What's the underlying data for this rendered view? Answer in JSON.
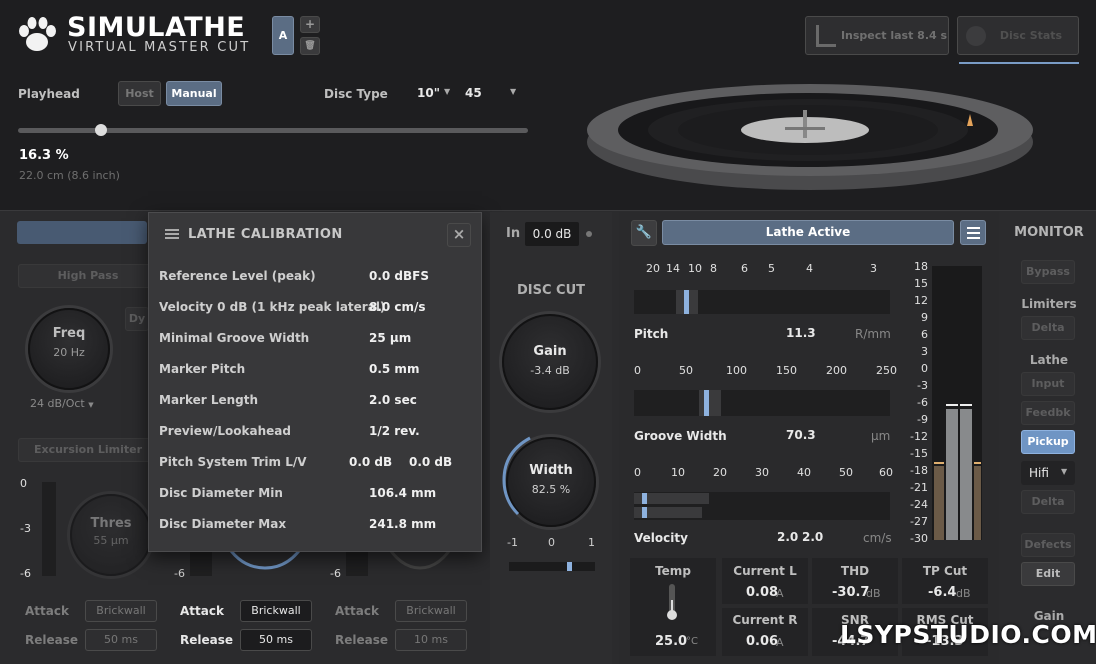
{
  "header": {
    "title": "SIMULATHE",
    "subtitle": "VIRTUAL MASTER CUT",
    "preset_slot": "A",
    "add_label": "+",
    "delete_label": "🗑",
    "inspect_label": "Inspect last 8.4 s",
    "disc_stats_label": "Disc Stats"
  },
  "playhead": {
    "label": "Playhead",
    "host_label": "Host",
    "manual_label": "Manual",
    "percent": "16.3 %",
    "position_value": 0.163,
    "distance": "22.0 cm (8.6 inch)"
  },
  "disc_type": {
    "label": "Disc Type",
    "size": "10\"",
    "speed": "45"
  },
  "calibration": {
    "title": "LATHE CALIBRATION",
    "rows": [
      {
        "label": "Reference Level (peak)",
        "value": "0.0 dBFS"
      },
      {
        "label": "Velocity 0 dB (1 kHz peak lateral)",
        "value": "8.0 cm/s"
      },
      {
        "label": "Minimal Groove Width",
        "value": "25 µm"
      },
      {
        "label": "Marker Pitch",
        "value": "0.5 mm"
      },
      {
        "label": "Marker Length",
        "value": "2.0 sec"
      },
      {
        "label": "Preview/Lookahead",
        "value": "1/2 rev."
      },
      {
        "label": "Pitch System Trim L/V",
        "value": "0.0 dB",
        "value2": "0.0 dB"
      },
      {
        "label": "Disc Diameter Min",
        "value": "106.4 mm"
      },
      {
        "label": "Disc Diameter Max",
        "value": "241.8 mm"
      }
    ]
  },
  "left_section": {
    "high_pass_label": "High Pass",
    "freq_label": "Freq",
    "freq_value": "20 Hz",
    "slope": "24 dB/Oct",
    "dyn_label": "Dy",
    "excursion_label": "Excursion Limiter",
    "scale": [
      "0",
      "-3",
      "-6"
    ],
    "scale_mid": [
      "-6",
      "-6"
    ],
    "thres_label": "Thres",
    "thres_value": "55 µm",
    "attack_label": "Attack",
    "release_label": "Release",
    "attack_values": [
      "Brickwall",
      "Brickwall",
      "Brickwall"
    ],
    "release_values": [
      "50 ms",
      "50 ms",
      "10 ms"
    ]
  },
  "disc_cut": {
    "in_label": "In",
    "in_value": "0.0 dB",
    "title": "DISC CUT",
    "gain_label": "Gain",
    "gain_value": "-3.4 dB",
    "width_label": "Width",
    "width_value": "82.5 %",
    "balance_scale": [
      "-1",
      "0",
      "1"
    ],
    "balance_value": 0.68
  },
  "lathe": {
    "status": "Lathe Active",
    "pitch_scale": [
      "20",
      "14",
      "10",
      "8",
      "6",
      "5",
      "4",
      "3"
    ],
    "pitch_label": "Pitch",
    "pitch_value": "11.3",
    "pitch_unit": "R/mm",
    "groove_scale": [
      "0",
      "50",
      "100",
      "150",
      "200",
      "250"
    ],
    "groove_label": "Groove Width",
    "groove_value": "70.3",
    "groove_unit": "µm",
    "velocity_scale": [
      "0",
      "10",
      "20",
      "30",
      "40",
      "50",
      "60"
    ],
    "velocity_label": "Velocity",
    "velocity_l": "2.0",
    "velocity_r": "2.0",
    "velocity_unit": "cm/s",
    "temp_label": "Temp",
    "temp_value": "25.0",
    "temp_unit": "°C",
    "current_l_label": "Current L",
    "current_l_value": "0.08",
    "current_r_label": "Current R",
    "current_r_value": "0.06",
    "current_unit": "A",
    "thd_label": "THD",
    "thd_value": "-30.7",
    "snr_label": "SNR",
    "snr_value": "-44.7",
    "db_unit": "dB",
    "tp_cut_label": "TP Cut",
    "tp_cut_value": "-6.4",
    "rms_cut_label": "RMS Cut",
    "rms_cut_value": "-13.3"
  },
  "meter": {
    "scale": [
      "18",
      "15",
      "12",
      "9",
      "6",
      "3",
      "0",
      "-3",
      "-6",
      "-9",
      "-12",
      "-15",
      "-18",
      "-21",
      "-24",
      "-27",
      "-30"
    ]
  },
  "monitor": {
    "title": "MONITOR",
    "bypass": "Bypass",
    "limiters_label": "Limiters",
    "delta1": "Delta",
    "lathe_label": "Lathe",
    "input": "Input",
    "feedbk": "Feedbk",
    "pickup": "Pickup",
    "hifi": "Hifi",
    "delta2": "Delta",
    "defects": "Defects",
    "edit": "Edit",
    "gain_label": "Gain"
  },
  "watermark": "LSYPSTUDIO.COM",
  "colors": {
    "accent": "#6f95c4",
    "panel": "#2b2b2d",
    "meter_fill": "#8a8a8c",
    "peak": "#e0b070"
  }
}
